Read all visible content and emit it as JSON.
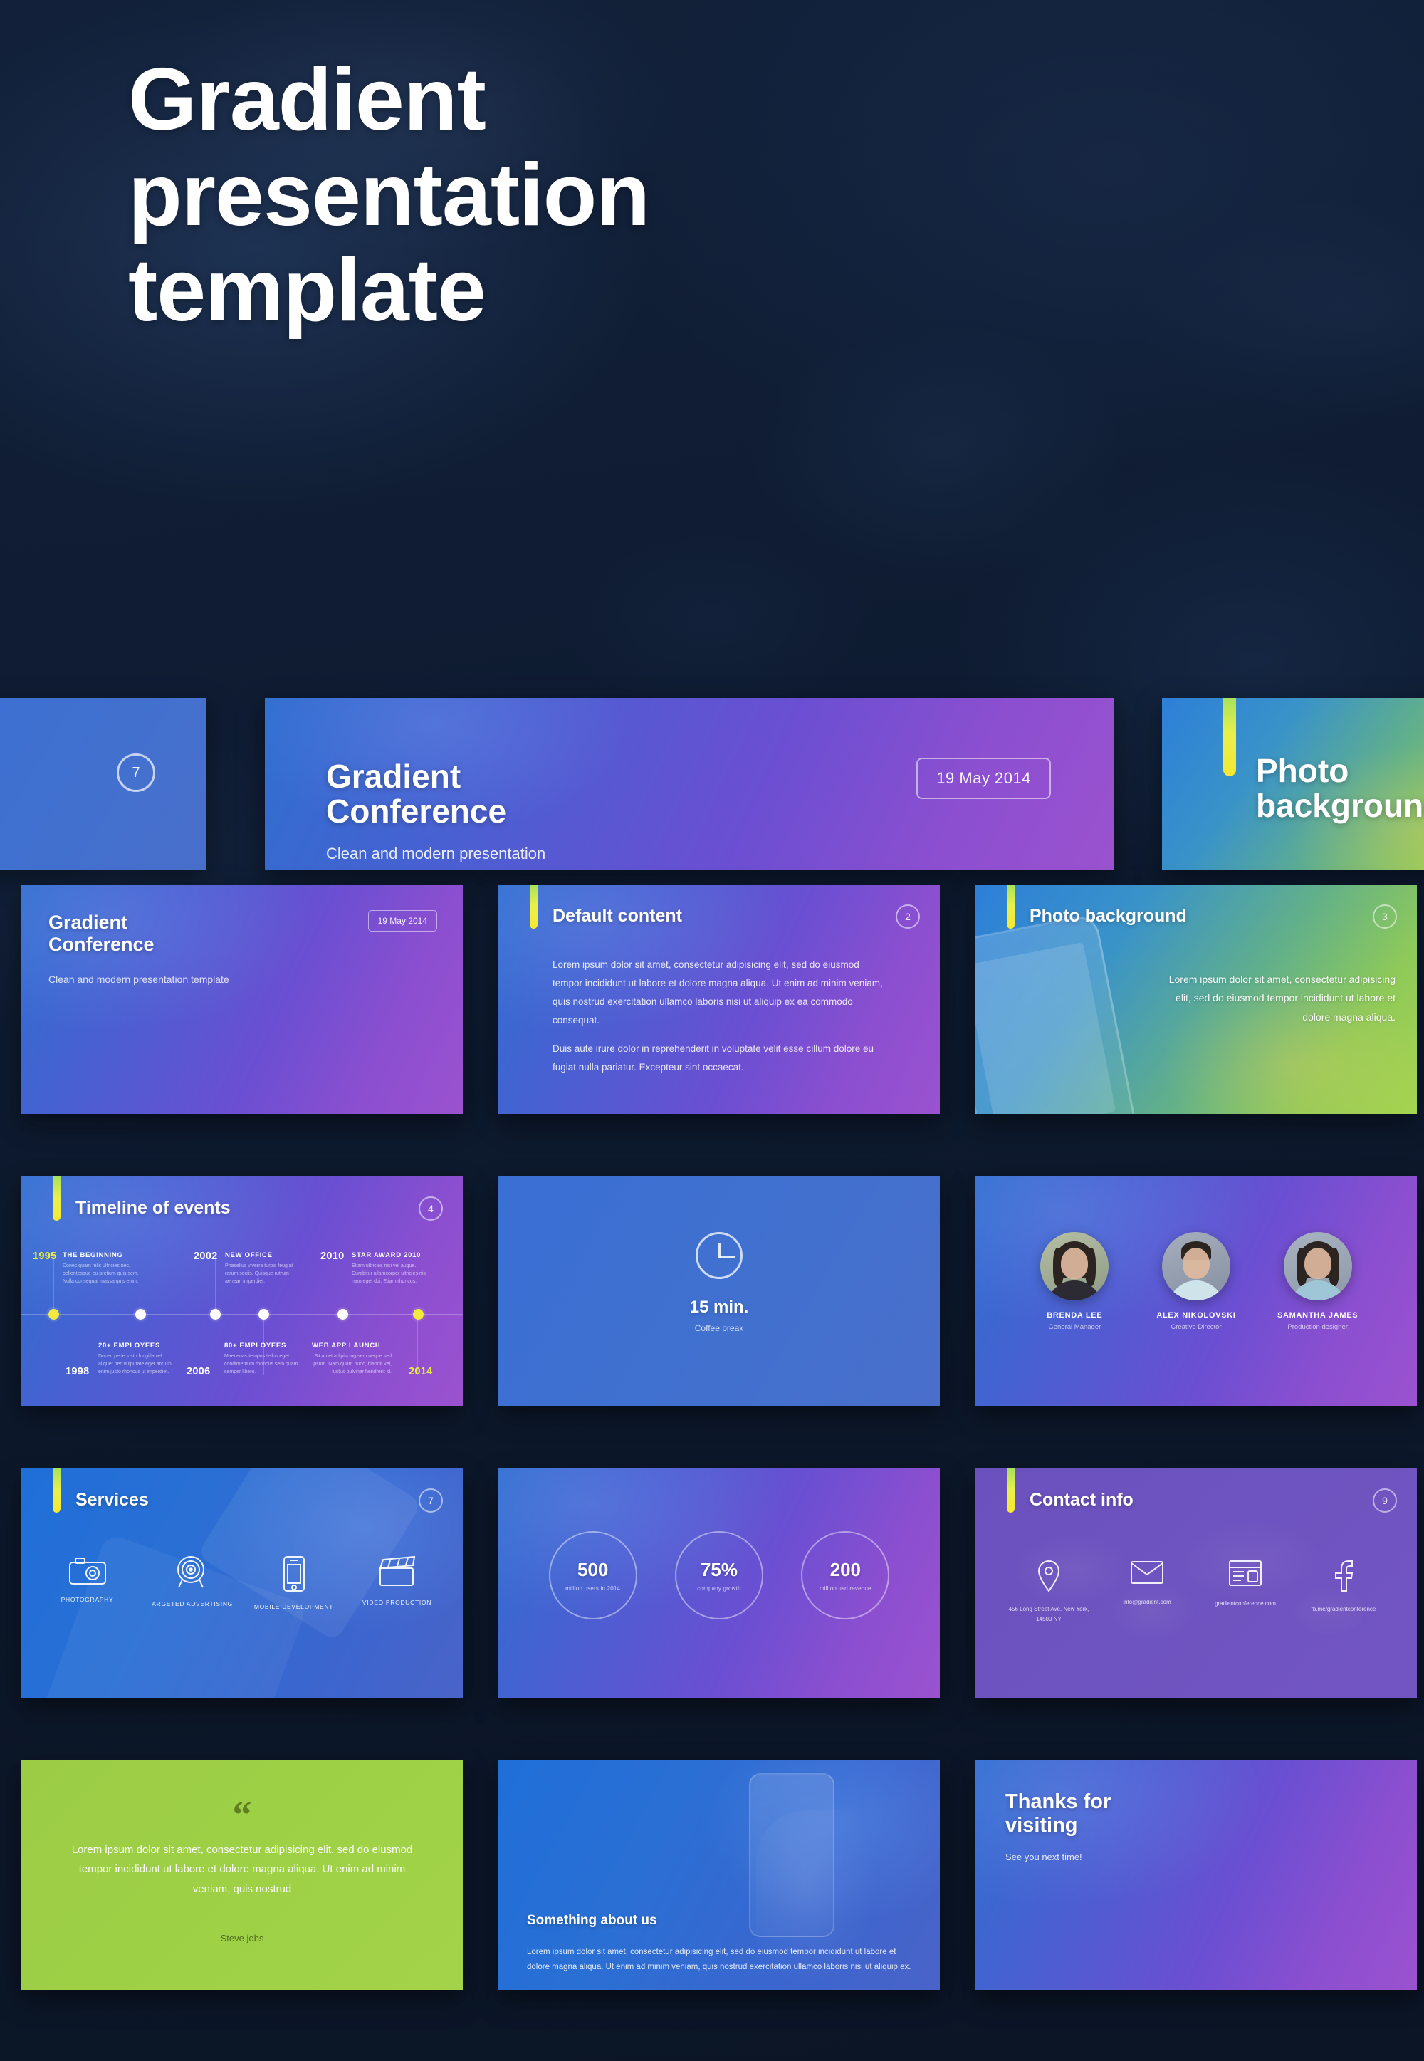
{
  "hero": {
    "lines": [
      "Gradient",
      "presentation",
      "template"
    ]
  },
  "banner": {
    "left": {
      "page_number": "7"
    },
    "mid": {
      "title_line1": "Gradient",
      "title_line2": "Conference",
      "subtitle": "Clean and modern presentation",
      "date": "19 May 2014"
    },
    "right": {
      "title": "Photo background"
    }
  },
  "slides": [
    {
      "id": "title-slide",
      "title_line1": "Gradient",
      "title_line2": "Conference",
      "subtitle": "Clean and modern presentation template",
      "date": "19 May 2014"
    },
    {
      "id": "default-content",
      "title": "Default content",
      "page_number": "2",
      "paragraphs": [
        "Lorem ipsum dolor sit amet, consectetur adipisicing elit, sed do eiusmod tempor incididunt ut labore et dolore magna aliqua. Ut enim ad minim veniam, quis nostrud exercitation ullamco laboris nisi ut aliquip ex ea commodo consequat.",
        "Duis aute irure dolor in reprehenderit in voluptate velit esse cillum dolore eu fugiat nulla pariatur. Excepteur sint occaecat."
      ]
    },
    {
      "id": "photo-background",
      "title": "Photo background",
      "page_number": "3",
      "body": "Lorem ipsum dolor sit amet, consectetur adipisicing elit, sed do eiusmod tempor incididunt ut labore et dolore magna aliqua."
    },
    {
      "id": "timeline-of-events",
      "title": "Timeline of events",
      "page_number": "4",
      "events_top": [
        {
          "year": "1995",
          "heading": "THE BEGINNING",
          "desc": "Donec quam felis ultricies nec, pellentesque eu pretium quis sem. Nulla consequat massa quis enim."
        },
        {
          "year": "2002",
          "heading": "NEW OFFICE",
          "desc": "Phasellus viverra turpis feugiat rerum sociis. Quisque rutrum aenean imperdiet."
        },
        {
          "year": "2010",
          "heading": "STAR AWARD 2010",
          "desc": "Etiam ultricies nisi vel augue. Curabitur ullamcorper ultricies nisi nam eget dui. Etiam rhoncus."
        }
      ],
      "events_bottom": [
        {
          "year": "1998",
          "heading": "20+ EMPLOYEES",
          "desc": "Donec pede justo fringilla vel aliquet nec vulputate eget arcu in enim justo rhoncus ut imperdiet."
        },
        {
          "year": "2006",
          "heading": "80+ EMPLOYEES",
          "desc": "Maecenas tempus tellus eget condimentum rhoncus sem quam semper libero."
        },
        {
          "year": "2014",
          "heading": "WEB APP LAUNCH",
          "desc": "Sit amet adipiscing sem neque sed ipsum. Nam quam nunc, blandit vel, luctus pulvinar hendrerit id."
        }
      ]
    },
    {
      "id": "coffee-break",
      "time": "15 min.",
      "label": "Coffee break"
    },
    {
      "id": "team",
      "members": [
        {
          "name": "BRENDA LEE",
          "role": "General Manager"
        },
        {
          "name": "ALEX NIKOLOVSKI",
          "role": "Creative Director"
        },
        {
          "name": "SAMANTHA JAMES",
          "role": "Production designer"
        }
      ]
    },
    {
      "id": "services",
      "title": "Services",
      "page_number": "7",
      "items": [
        {
          "icon": "camera-icon",
          "label": "PHOTOGRAPHY"
        },
        {
          "icon": "target-icon",
          "label": "TARGETED ADVERTISING"
        },
        {
          "icon": "mobile-icon",
          "label": "MOBILE DEVELOPMENT"
        },
        {
          "icon": "clapperboard-icon",
          "label": "VIDEO PRODUCTION"
        }
      ]
    },
    {
      "id": "statistics",
      "stats": [
        {
          "value": "500",
          "caption": "million users in 2014"
        },
        {
          "value": "75%",
          "caption": "company growth"
        },
        {
          "value": "200",
          "caption": "million usd revenue"
        }
      ]
    },
    {
      "id": "contact-info",
      "title": "Contact info",
      "page_number": "9",
      "items": [
        {
          "icon": "location-pin-icon",
          "text": "456 Long Street Ave. New York, 14500 NY"
        },
        {
          "icon": "envelope-icon",
          "text": "info@gradient.com"
        },
        {
          "icon": "browser-window-icon",
          "text": "gradientconference.com"
        },
        {
          "icon": "facebook-icon",
          "text": "fb.me/gradientconference"
        }
      ]
    },
    {
      "id": "quote",
      "quote_mark": "“",
      "text": "Lorem ipsum dolor sit amet, consectetur adipisicing elit, sed do eiusmod tempor incididunt ut labore et dolore magna aliqua. Ut enim ad minim veniam, quis nostrud",
      "author": "Steve jobs"
    },
    {
      "id": "about-us",
      "title": "Something about us",
      "body": "Lorem ipsum dolor sit amet, consectetur adipisicing elit, sed do eiusmod tempor incididunt ut labore et dolore magna aliqua. Ut enim ad minim veniam, quis nostrud exercitation ullamco laboris nisi ut aliquip ex."
    },
    {
      "id": "thanks",
      "title_line1": "Thanks for",
      "title_line2": "visiting",
      "subtitle": "See you next time!"
    }
  ],
  "colors": {
    "page_background": "#0c1729",
    "accent_yellow": "#f2ea3c",
    "accent_green": "#9ccc46",
    "gradient_blue": "#2f6fd0",
    "gradient_purple": "#9b52cf"
  }
}
